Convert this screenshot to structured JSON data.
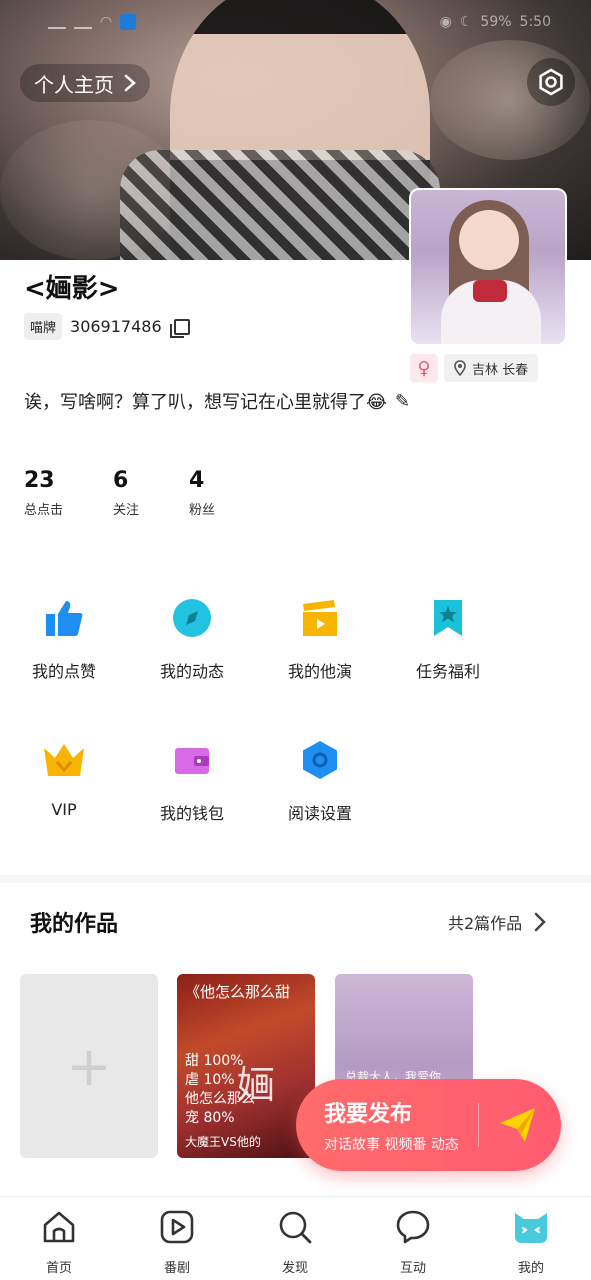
{
  "status_bar": {
    "battery": "59%",
    "time": "5:50"
  },
  "header": {
    "profile_link_label": "个人主页"
  },
  "profile": {
    "name": "<婳影>",
    "id_tag": "喵牌",
    "id_number": "306917486",
    "gender_symbol": "♀",
    "location": "吉林 长春",
    "bio": "诶，写啥啊？算了叭，想写记在心里就得了😂"
  },
  "stats": [
    {
      "value": "23",
      "label": "总点击"
    },
    {
      "value": "6",
      "label": "关注"
    },
    {
      "value": "4",
      "label": "粉丝"
    }
  ],
  "menu": [
    {
      "label": "我的点赞",
      "icon": "thumbs-up-icon",
      "color": "#1e8ff0"
    },
    {
      "label": "我的动态",
      "icon": "compass-icon",
      "color": "#22c3e0"
    },
    {
      "label": "我的他演",
      "icon": "clapperboard-icon",
      "color": "#f7b500"
    },
    {
      "label": "任务福利",
      "icon": "bookmark-star-icon",
      "color": "#19c2d8"
    },
    {
      "label": "VIP",
      "icon": "crown-icon",
      "color": "#f7b500"
    },
    {
      "label": "我的钱包",
      "icon": "wallet-icon",
      "color": "#d86ae8"
    },
    {
      "label": "阅读设置",
      "icon": "hexagon-settings-icon",
      "color": "#1e8ff0"
    }
  ],
  "works": {
    "title": "我的作品",
    "count_label": "共2篇作品",
    "add_symbol": "+",
    "card1": {
      "title": "《他怎么那么甜",
      "lines": "甜 100%\n虐 10%\n他怎么那么\n宠 80%",
      "big": "婳",
      "subtitle": "大魔王VS他的"
    },
    "card2": {
      "caption": "总裁大人，我爱你"
    }
  },
  "publish": {
    "title": "我要发布",
    "subtitle": "对话故事 视频番 动态"
  },
  "bottom_nav": [
    {
      "label": "首页",
      "icon": "home-icon"
    },
    {
      "label": "番剧",
      "icon": "play-icon"
    },
    {
      "label": "发现",
      "icon": "search-icon"
    },
    {
      "label": "互动",
      "icon": "chat-bubble-icon"
    },
    {
      "label": "我的",
      "icon": "cat-face-icon"
    }
  ]
}
